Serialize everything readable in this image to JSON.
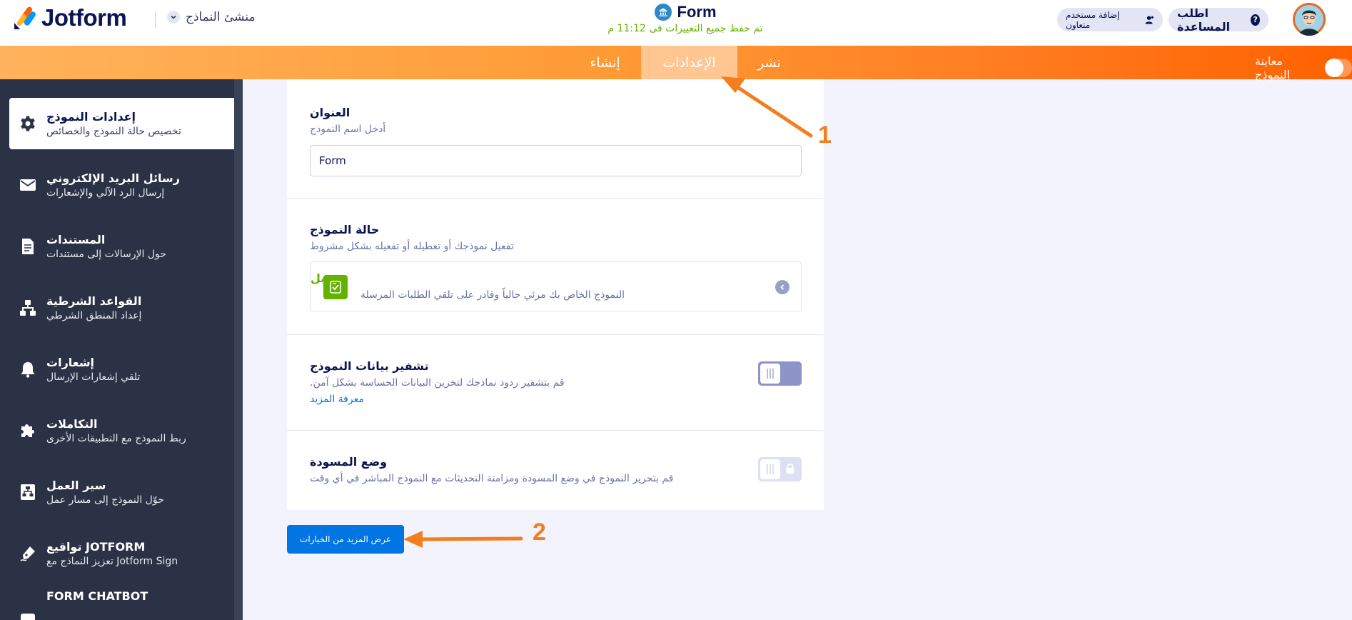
{
  "header": {
    "logo_text": "Jotform",
    "builder_label": "منشئ النماذج",
    "form_title": "Form",
    "saved_status": "تم حفظ جميع التغييرات فى 11:12 م",
    "help_label": "اطلب المساعدة",
    "collab_label": "إضافة مستخدم متعاون"
  },
  "tabs": {
    "publish": "نشر",
    "settings": "الإعدادات",
    "build": "إنشاء"
  },
  "preview_label": "معاينة النموذج",
  "sidebar": {
    "items": [
      {
        "title": "إعدادات النموذج",
        "subtitle": "تخصيص حالة النموذج والخصائص"
      },
      {
        "title": "رسائل البريد الإلكتروني",
        "subtitle": "إرسال الرد الآلي والإشعارات"
      },
      {
        "title": "المستندات",
        "subtitle": "حول الإرسالات إلى مستندات"
      },
      {
        "title": "القواعد الشرطية",
        "subtitle": "إعداد المنطق الشرطي"
      },
      {
        "title": "إشعارات",
        "subtitle": "تلقي إشعارات الإرسال"
      },
      {
        "title": "التكاملات",
        "subtitle": "ربط النموذج مع التطبيقات الأخرى"
      },
      {
        "title": "سير العمل",
        "subtitle": "حوّل النموذج إلى مسار عمل"
      },
      {
        "title": "تواقيع JOTFORM",
        "subtitle": "تعزيز النماذج مع Jotform Sign"
      },
      {
        "title": "FORM CHATBOT",
        "subtitle": ""
      }
    ]
  },
  "settings": {
    "title_label": "العنوان",
    "title_desc": "أدخل اسم النموذج",
    "title_value": "Form",
    "status_label": "حالة النموذج",
    "status_desc": "تفعيل نموذجك أو تعطيله أو تفعيله بشكل مشروط",
    "status_value": "تفعيل",
    "status_value_desc": "النموذج الخاص بك مرئي حالياً وقادر على تلقي الطلبات المرسلة",
    "encrypt_label": "تشفير بيانات النموذج",
    "encrypt_desc": ".قم بتشفير ردود نماذجك لتخزين البيانات الحساسة بشكل آمن",
    "encrypt_link": "معرفة المزيد",
    "draft_label": "وضع المسودة",
    "draft_desc": "قم بتحرير النموذج في وضع المسودة ومزامنة التحديثات مع النموذج المباشر في أي وقت"
  },
  "more_options_label": "عرض المزيد من الخيارات",
  "annotations": [
    "1",
    "2"
  ],
  "colors": {
    "accent_orange": "#ff7c20",
    "sidebar_bg": "#2b3245",
    "primary_blue": "#0075e3",
    "success_green": "#64b200"
  }
}
